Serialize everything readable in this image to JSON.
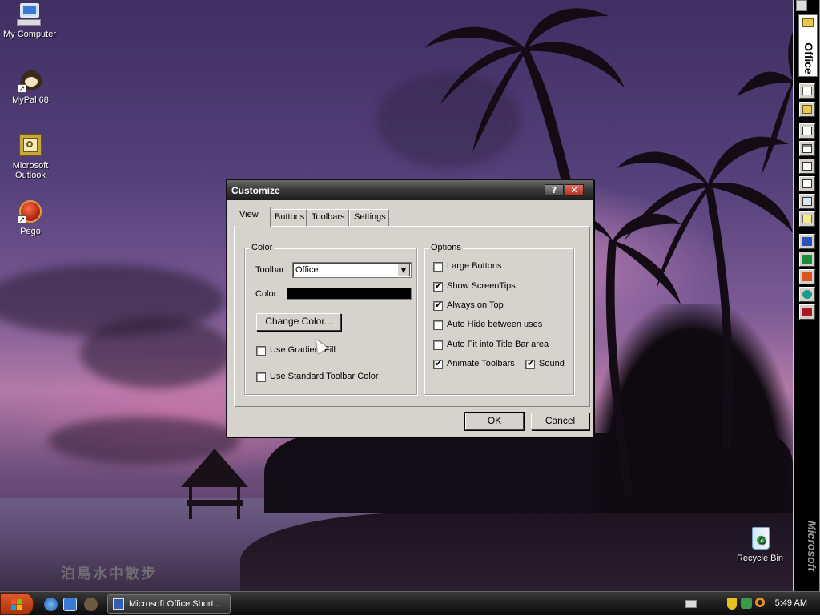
{
  "desktop": {
    "icons": [
      {
        "label": "My Computer",
        "icon": "my-computer-icon"
      },
      {
        "label": "MyPal 68",
        "icon": "mypal-browser-icon"
      },
      {
        "label": "Microsoft\nOutlook",
        "icon": "outlook-icon"
      },
      {
        "label": "Pego",
        "icon": "pego-icon"
      },
      {
        "label": "Recycle Bin",
        "icon": "recycle-bin-icon"
      }
    ],
    "watermark": "泊島水中散步"
  },
  "dialog": {
    "title": "Customize",
    "help_label": "?",
    "close_label": "✕",
    "tabs": [
      "View",
      "Buttons",
      "Toolbars",
      "Settings"
    ],
    "active_tab": "View",
    "color_group": {
      "legend": "Color",
      "toolbar_label": "Toolbar:",
      "toolbar_value": "Office",
      "color_label": "Color:",
      "color_value": "#000000",
      "change_color_button": "Change Color...",
      "use_gradient_fill": {
        "label": "Use Gradient Fill",
        "checked": false
      },
      "use_standard_toolbar_color": {
        "label": "Use Standard Toolbar Color",
        "checked": false
      }
    },
    "options_group": {
      "legend": "Options",
      "items": [
        {
          "label": "Large Buttons",
          "checked": false
        },
        {
          "label": "Show ScreenTips",
          "checked": true
        },
        {
          "label": "Always on Top",
          "checked": true
        },
        {
          "label": "Auto Hide between uses",
          "checked": false
        },
        {
          "label": "Auto Fit into Title Bar area",
          "checked": false
        },
        {
          "label": "Animate Toolbars",
          "checked": true
        },
        {
          "label": "Sound",
          "checked": true
        }
      ]
    },
    "ok_label": "OK",
    "cancel_label": "Cancel"
  },
  "office_bar": {
    "label": "Office",
    "brand": "Microsoft",
    "buttons": [
      "new-office-document-icon",
      "open-office-document-icon",
      "new-message-icon",
      "new-appointment-icon",
      "new-task-icon",
      "new-contact-icon",
      "new-journal-entry-icon",
      "new-note-icon",
      "word-icon",
      "excel-icon",
      "powerpoint-icon",
      "publisher-icon",
      "access-icon"
    ]
  },
  "taskbar": {
    "task_label": "Microsoft Office Short...",
    "clock": "5:49 AM"
  },
  "colors": {
    "taskbar": "#1f1f1f",
    "dialog_face": "#d6d3ce",
    "title_bar": "#3b3b3b",
    "close_red": "#c0402a"
  }
}
